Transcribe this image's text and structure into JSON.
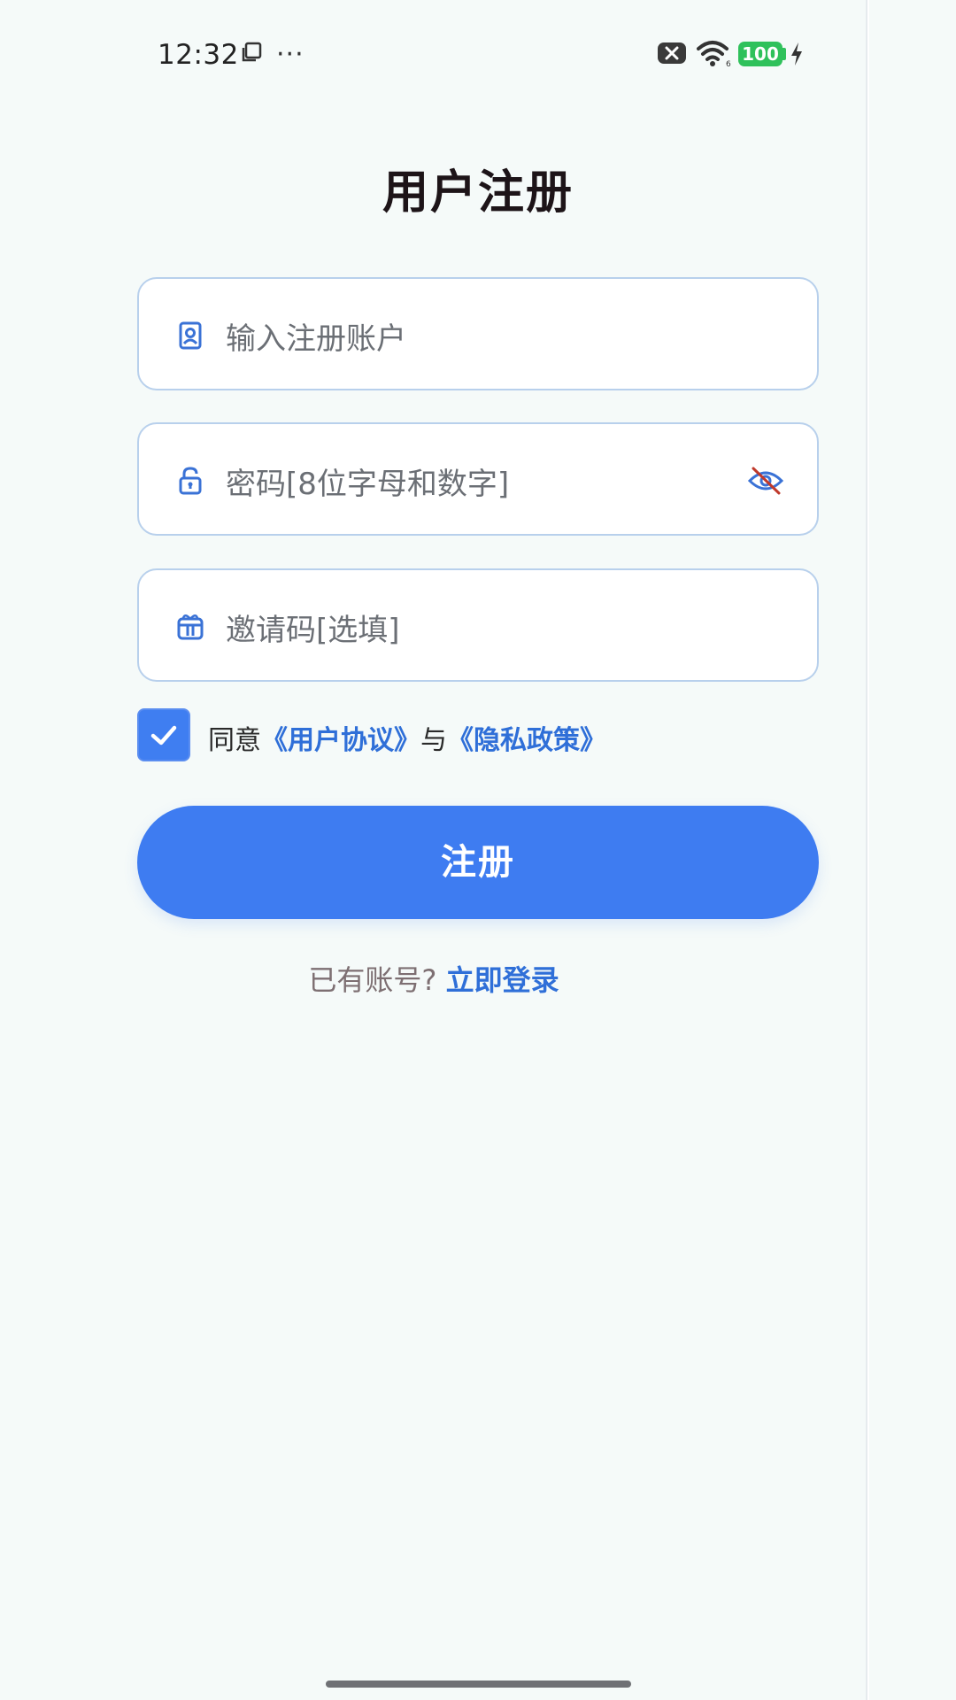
{
  "status_bar": {
    "time": "12:32",
    "more": "···",
    "battery": "100"
  },
  "page": {
    "title": "用户注册"
  },
  "form": {
    "account_placeholder": "输入注册账户",
    "password_placeholder": "密码[8位字母和数字]",
    "invite_placeholder": "邀请码[选填]"
  },
  "agreement": {
    "checked": true,
    "prefix": "同意",
    "user_agreement": "《用户协议》",
    "and": "与",
    "privacy_policy": "《隐私政策》"
  },
  "register_button": {
    "label": "注册"
  },
  "login_prompt": {
    "text": "已有账号?",
    "link": "立即登录"
  },
  "colors": {
    "primary": "#3e7cf1",
    "link": "#2f6fd8",
    "battery": "#2fc15b",
    "background": "#f5faf9"
  },
  "icons": {
    "account": "user-card-icon",
    "password": "lock-icon",
    "toggle_password": "eye-off-icon",
    "invite": "gift-icon",
    "checkbox": "check-icon"
  }
}
